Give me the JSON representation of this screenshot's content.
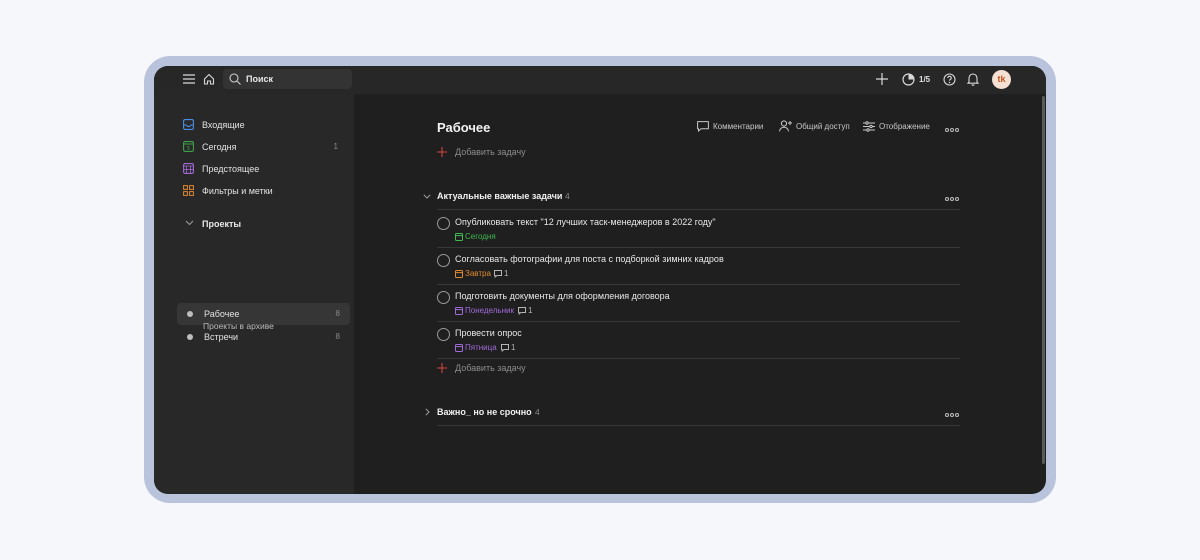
{
  "topbar": {
    "search_label": "Поиск",
    "karma": "1/5",
    "avatar_initials": "tk"
  },
  "sidebar": {
    "items": [
      {
        "label": "Входящие",
        "count": "",
        "icon": "inbox-icon",
        "color": "#4a8fe7"
      },
      {
        "label": "Сегодня",
        "count": "1",
        "icon": "calendar-today-icon",
        "color": "#3fa14a"
      },
      {
        "label": "Предстоящее",
        "count": "",
        "icon": "calendar-upcoming-icon",
        "color": "#a06ad8"
      },
      {
        "label": "Фильтры и метки",
        "count": "",
        "icon": "filters-grid-icon",
        "color": "#e0892f"
      }
    ],
    "projects_label": "Проекты",
    "projects": [
      {
        "label": "Рабочее",
        "count": "8"
      },
      {
        "label": "Встречи",
        "count": "8"
      }
    ],
    "archive_label": "Проекты в архиве"
  },
  "main": {
    "title": "Рабочее",
    "header_buttons": {
      "comments": "Комментарии",
      "share": "Общий доступ",
      "view": "Отображение"
    },
    "add_task_label": "Добавить задачу",
    "sections": [
      {
        "title": "Актуальные важные задачи",
        "count": "4",
        "tasks": [
          {
            "title": "Опубликовать текст \"12 лучших таск-менеджеров в 2022 году\"",
            "date": "Сегодня",
            "date_color": "#3fb950",
            "comments": ""
          },
          {
            "title": "Согласовать фотографии для поста с подборкой зимних кадров",
            "date": "Завтра",
            "date_color": "#e0892f",
            "comments": "1"
          },
          {
            "title": "Подготовить документы для оформления договора",
            "date": "Понедельник",
            "date_color": "#a06ad8",
            "comments": "1"
          },
          {
            "title": "Провести опрос",
            "date": "Пятница",
            "date_color": "#a06ad8",
            "comments": "1"
          }
        ],
        "add_task_label": "Добавить задачу"
      },
      {
        "title": "Важно_ но не срочно",
        "count": "4"
      }
    ]
  }
}
